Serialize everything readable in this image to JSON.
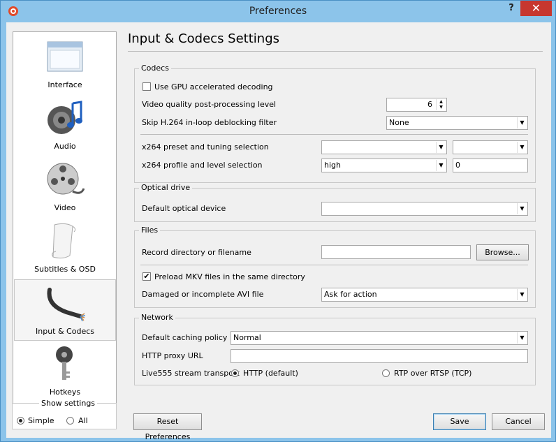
{
  "window": {
    "title": "Preferences",
    "help_glyph": "?",
    "close_glyph": "✕"
  },
  "sidebar": {
    "items": [
      {
        "label": "Interface",
        "icon": "interface-icon",
        "selected": false
      },
      {
        "label": "Audio",
        "icon": "audio-icon",
        "selected": false
      },
      {
        "label": "Video",
        "icon": "video-icon",
        "selected": false
      },
      {
        "label": "Subtitles & OSD",
        "icon": "subtitles-icon",
        "selected": false
      },
      {
        "label": "Input & Codecs",
        "icon": "input-codecs-icon",
        "selected": true
      },
      {
        "label": "Hotkeys",
        "icon": "hotkeys-icon",
        "selected": false
      }
    ]
  },
  "show_settings": {
    "legend": "Show settings",
    "simple_label": "Simple",
    "all_label": "All",
    "selected": "Simple"
  },
  "main": {
    "heading": "Input & Codecs Settings",
    "codecs": {
      "legend": "Codecs",
      "gpu_label": "Use GPU accelerated decoding",
      "gpu_checked": false,
      "quality_label": "Video quality post-processing level",
      "quality_value": "6",
      "skip_label": "Skip H.264 in-loop deblocking filter",
      "skip_value": "None",
      "x264_preset_label": "x264 preset and tuning selection",
      "x264_preset_value": "",
      "x264_tuning_value": "",
      "x264_profile_label": "x264 profile and level selection",
      "x264_profile_value": "high",
      "x264_level_value": "0"
    },
    "optical": {
      "legend": "Optical drive",
      "device_label": "Default optical device",
      "device_value": ""
    },
    "files": {
      "legend": "Files",
      "record_label": "Record directory or filename",
      "record_value": "",
      "browse_label": "Browse...",
      "mkv_label": "Preload MKV files in the same directory",
      "mkv_checked": true,
      "avi_label": "Damaged or incomplete AVI file",
      "avi_value": "Ask for action"
    },
    "network": {
      "legend": "Network",
      "caching_label": "Default caching policy",
      "caching_value": "Normal",
      "proxy_label": "HTTP proxy URL",
      "proxy_value": "",
      "live555_label": "Live555 stream transport",
      "http_label": "HTTP (default)",
      "rtp_label": "RTP over RTSP (TCP)",
      "transport_selected": "HTTP (default)"
    }
  },
  "footer": {
    "reset_label": "Reset Preferences",
    "save_label": "Save",
    "cancel_label": "Cancel"
  },
  "colors": {
    "titlebar": "#8cc4ea",
    "close": "#c7372f",
    "panel": "#f0f0f0"
  }
}
